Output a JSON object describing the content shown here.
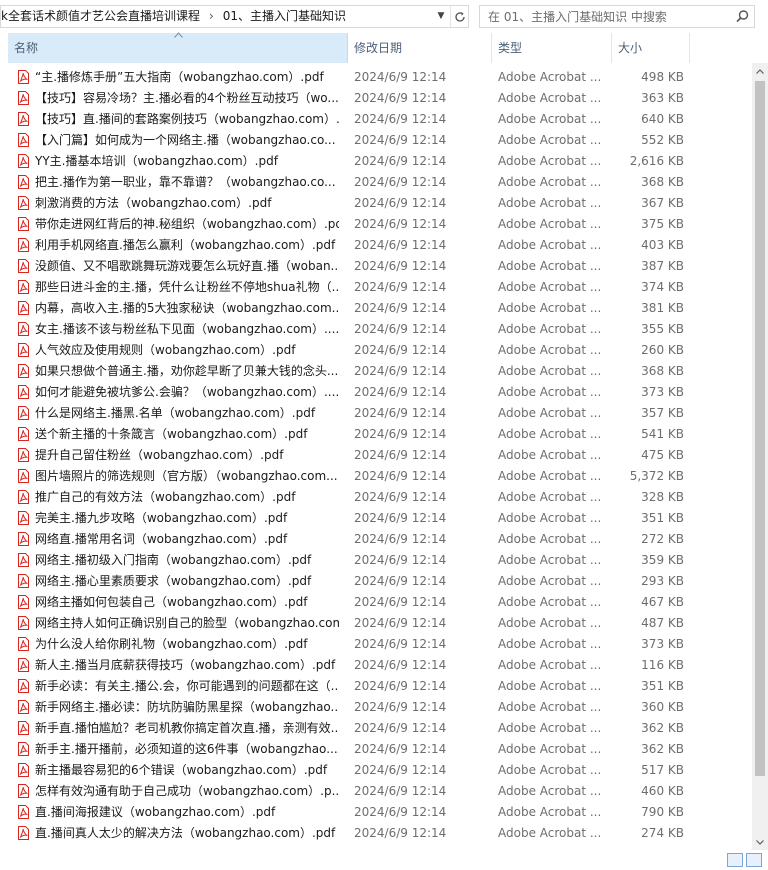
{
  "address": {
    "crumbs": [
      "k全套话术颜值才艺公会直播培训课程",
      "01、主播入门基础知识"
    ],
    "separator": "›"
  },
  "search": {
    "placeholder": "在 01、主播入门基础知识 中搜索"
  },
  "columns": {
    "name": "名称",
    "date": "修改日期",
    "type": "类型",
    "size": "大小"
  },
  "files": [
    {
      "name": "“主.播修炼手册”五大指南（wobangzhao.com）.pdf",
      "date": "2024/6/9 12:14",
      "type": "Adobe Acrobat ...",
      "size": "498 KB"
    },
    {
      "name": "【技巧】容易冷场？主.播必看的4个粉丝互动技巧（wo...",
      "date": "2024/6/9 12:14",
      "type": "Adobe Acrobat ...",
      "size": "363 KB"
    },
    {
      "name": "【技巧】直.播间的套路案例技巧（wobangzhao.com）...",
      "date": "2024/6/9 12:14",
      "type": "Adobe Acrobat ...",
      "size": "640 KB"
    },
    {
      "name": "【入门篇】如何成为一个网络主.播（wobangzhao.co...",
      "date": "2024/6/9 12:14",
      "type": "Adobe Acrobat ...",
      "size": "552 KB"
    },
    {
      "name": "YY主.播基本培训（wobangzhao.com）.pdf",
      "date": "2024/6/9 12:14",
      "type": "Adobe Acrobat ...",
      "size": "2,616 KB"
    },
    {
      "name": "把主.播作为第一职业，靠不靠谱？（wobangzhao.co...",
      "date": "2024/6/9 12:14",
      "type": "Adobe Acrobat ...",
      "size": "368 KB"
    },
    {
      "name": "刺激消费的方法（wobangzhao.com）.pdf",
      "date": "2024/6/9 12:14",
      "type": "Adobe Acrobat ...",
      "size": "367 KB"
    },
    {
      "name": "带你走进网红背后的神.秘组织（wobangzhao.com）.pdf",
      "date": "2024/6/9 12:14",
      "type": "Adobe Acrobat ...",
      "size": "375 KB"
    },
    {
      "name": "利用手机网络直.播怎么赢利（wobangzhao.com）.pdf",
      "date": "2024/6/9 12:14",
      "type": "Adobe Acrobat ...",
      "size": "403 KB"
    },
    {
      "name": "没颜值、又不唱歌跳舞玩游戏要怎么玩好直.播（woban...",
      "date": "2024/6/9 12:14",
      "type": "Adobe Acrobat ...",
      "size": "387 KB"
    },
    {
      "name": "那些日进斗金的主.播，凭什么让粉丝不停地shua礼物（...",
      "date": "2024/6/9 12:14",
      "type": "Adobe Acrobat ...",
      "size": "374 KB"
    },
    {
      "name": "内幕，高收入主.播的5大独家秘诀（wobangzhao.com...",
      "date": "2024/6/9 12:14",
      "type": "Adobe Acrobat ...",
      "size": "381 KB"
    },
    {
      "name": "女主.播该不该与粉丝私下见面（wobangzhao.com）....",
      "date": "2024/6/9 12:14",
      "type": "Adobe Acrobat ...",
      "size": "355 KB"
    },
    {
      "name": "人气效应及使用规则（wobangzhao.com）.pdf",
      "date": "2024/6/9 12:14",
      "type": "Adobe Acrobat ...",
      "size": "260 KB"
    },
    {
      "name": "如果只想做个普通主.播，劝你趁早断了贝兼大钱的念头...",
      "date": "2024/6/9 12:14",
      "type": "Adobe Acrobat ...",
      "size": "368 KB"
    },
    {
      "name": "如何才能避免被坑爹公.会骗？（wobangzhao.com）....",
      "date": "2024/6/9 12:14",
      "type": "Adobe Acrobat ...",
      "size": "373 KB"
    },
    {
      "name": "什么是网络主.播黑.名单（wobangzhao.com）.pdf",
      "date": "2024/6/9 12:14",
      "type": "Adobe Acrobat ...",
      "size": "357 KB"
    },
    {
      "name": "送个新主播的十条箴言（wobangzhao.com）.pdf",
      "date": "2024/6/9 12:14",
      "type": "Adobe Acrobat ...",
      "size": "541 KB"
    },
    {
      "name": "提升自己留住粉丝（wobangzhao.com）.pdf",
      "date": "2024/6/9 12:14",
      "type": "Adobe Acrobat ...",
      "size": "475 KB"
    },
    {
      "name": "图片墙照片的筛选规则（官方版）（wobangzhao.com...",
      "date": "2024/6/9 12:14",
      "type": "Adobe Acrobat ...",
      "size": "5,372 KB"
    },
    {
      "name": "推广自己的有效方法（wobangzhao.com）.pdf",
      "date": "2024/6/9 12:14",
      "type": "Adobe Acrobat ...",
      "size": "328 KB"
    },
    {
      "name": "完美主.播九步攻略（wobangzhao.com）.pdf",
      "date": "2024/6/9 12:14",
      "type": "Adobe Acrobat ...",
      "size": "351 KB"
    },
    {
      "name": "网络直.播常用名词（wobangzhao.com）.pdf",
      "date": "2024/6/9 12:14",
      "type": "Adobe Acrobat ...",
      "size": "272 KB"
    },
    {
      "name": "网络主.播初级入门指南（wobangzhao.com）.pdf",
      "date": "2024/6/9 12:14",
      "type": "Adobe Acrobat ...",
      "size": "359 KB"
    },
    {
      "name": "网络主.播心里素质要求（wobangzhao.com）.pdf",
      "date": "2024/6/9 12:14",
      "type": "Adobe Acrobat ...",
      "size": "293 KB"
    },
    {
      "name": "网络主播如何包装自己（wobangzhao.com）.pdf",
      "date": "2024/6/9 12:14",
      "type": "Adobe Acrobat ...",
      "size": "467 KB"
    },
    {
      "name": "网络主持人如何正确识别自己的脸型（wobangzhao.com）...",
      "date": "2024/6/9 12:14",
      "type": "Adobe Acrobat ...",
      "size": "487 KB"
    },
    {
      "name": "为什么没人给你刷礼物（wobangzhao.com）.pdf",
      "date": "2024/6/9 12:14",
      "type": "Adobe Acrobat ...",
      "size": "373 KB"
    },
    {
      "name": "新人主.播当月底薪获得技巧（wobangzhao.com）.pdf",
      "date": "2024/6/9 12:14",
      "type": "Adobe Acrobat ...",
      "size": "116 KB"
    },
    {
      "name": "新手必读：有关主.播公.会，你可能遇到的问题都在这（...",
      "date": "2024/6/9 12:14",
      "type": "Adobe Acrobat ...",
      "size": "351 KB"
    },
    {
      "name": "新手网络主.播必读：防坑防骗防黑星探（wobangzhao...",
      "date": "2024/6/9 12:14",
      "type": "Adobe Acrobat ...",
      "size": "360 KB"
    },
    {
      "name": "新手直.播怕尴尬？老司机教你搞定首次直.播，亲测有效...",
      "date": "2024/6/9 12:14",
      "type": "Adobe Acrobat ...",
      "size": "362 KB"
    },
    {
      "name": "新手主.播开播前，必须知道的这6件事（wobangzhao....",
      "date": "2024/6/9 12:14",
      "type": "Adobe Acrobat ...",
      "size": "362 KB"
    },
    {
      "name": "新主播最容易犯的6个错误（wobangzhao.com）.pdf",
      "date": "2024/6/9 12:14",
      "type": "Adobe Acrobat ...",
      "size": "517 KB"
    },
    {
      "name": "怎样有效沟通有助于自己成功（wobangzhao.com）.p...",
      "date": "2024/6/9 12:14",
      "type": "Adobe Acrobat ...",
      "size": "460 KB"
    },
    {
      "name": "直.播间海报建议（wobangzhao.com）.pdf",
      "date": "2024/6/9 12:14",
      "type": "Adobe Acrobat ...",
      "size": "790 KB"
    },
    {
      "name": "直.播间真人太少的解决方法（wobangzhao.com）.pdf",
      "date": "2024/6/9 12:14",
      "type": "Adobe Acrobat ...",
      "size": "274 KB"
    }
  ],
  "icons": {
    "file": "pdf-file-icon",
    "refresh": "refresh-icon",
    "search": "search-icon",
    "dropdown": "chevron-down-icon"
  },
  "colors": {
    "pdf_red": "#d9251d",
    "header_selected": "#d9ebf9",
    "header_text": "#4c607a",
    "secondary_text": "#6d6d6d"
  }
}
